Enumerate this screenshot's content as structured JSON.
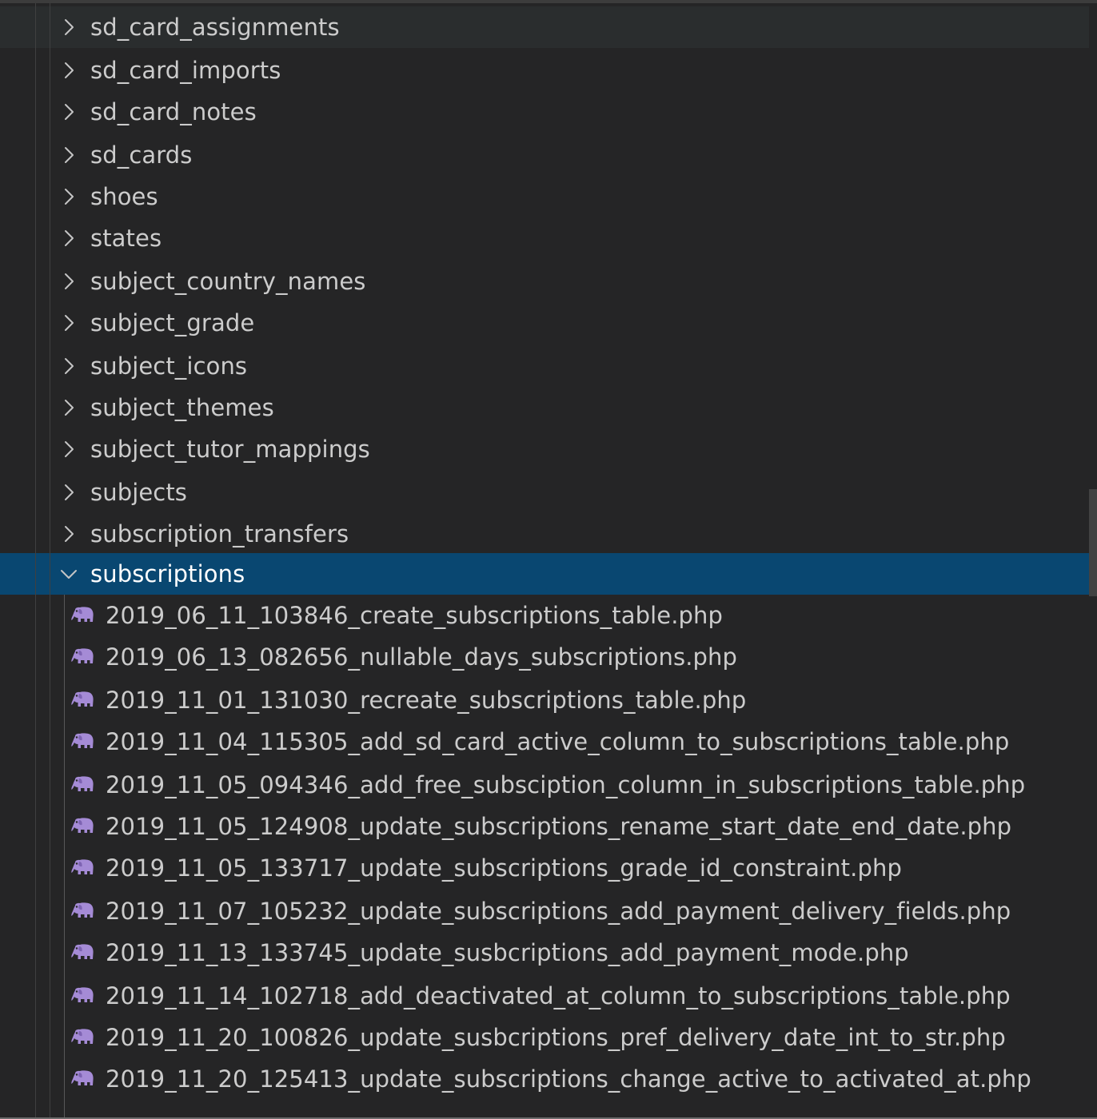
{
  "explorer": {
    "folders": [
      {
        "label": "sd_card_assignments",
        "expanded": false
      },
      {
        "label": "sd_card_imports",
        "expanded": false
      },
      {
        "label": "sd_card_notes",
        "expanded": false
      },
      {
        "label": "sd_cards",
        "expanded": false
      },
      {
        "label": "shoes",
        "expanded": false
      },
      {
        "label": "states",
        "expanded": false
      },
      {
        "label": "subject_country_names",
        "expanded": false
      },
      {
        "label": "subject_grade",
        "expanded": false
      },
      {
        "label": "subject_icons",
        "expanded": false
      },
      {
        "label": "subject_themes",
        "expanded": false
      },
      {
        "label": "subject_tutor_mappings",
        "expanded": false
      },
      {
        "label": "subjects",
        "expanded": false
      },
      {
        "label": "subscription_transfers",
        "expanded": false
      }
    ],
    "open_folder": {
      "label": "subscriptions",
      "expanded": true
    },
    "files": [
      {
        "label": "2019_06_11_103846_create_subscriptions_table.php",
        "icon": "php-elephant-icon"
      },
      {
        "label": "2019_06_13_082656_nullable_days_subscriptions.php",
        "icon": "php-elephant-icon"
      },
      {
        "label": "2019_11_01_131030_recreate_subscriptions_table.php",
        "icon": "php-elephant-icon"
      },
      {
        "label": "2019_11_04_115305_add_sd_card_active_column_to_subscriptions_table.php",
        "icon": "php-elephant-icon"
      },
      {
        "label": "2019_11_05_094346_add_free_subsciption_column_in_subscriptions_table.php",
        "icon": "php-elephant-icon"
      },
      {
        "label": "2019_11_05_124908_update_subscriptions_rename_start_date_end_date.php",
        "icon": "php-elephant-icon"
      },
      {
        "label": "2019_11_05_133717_update_subscriptions_grade_id_constraint.php",
        "icon": "php-elephant-icon"
      },
      {
        "label": "2019_11_07_105232_update_subscriptions_add_payment_delivery_fields.php",
        "icon": "php-elephant-icon"
      },
      {
        "label": "2019_11_13_133745_update_susbcriptions_add_payment_mode.php",
        "icon": "php-elephant-icon"
      },
      {
        "label": "2019_11_14_102718_add_deactivated_at_column_to_subscriptions_table.php",
        "icon": "php-elephant-icon"
      },
      {
        "label": "2019_11_20_100826_update_susbcriptions_pref_delivery_date_int_to_str.php",
        "icon": "php-elephant-icon"
      },
      {
        "label": "2019_11_20_125413_update_subscriptions_change_active_to_activated_at.php",
        "icon": "php-elephant-icon"
      }
    ],
    "colors": {
      "background": "#252526",
      "selection": "#094771",
      "hover_row": "#2a2d2e",
      "text": "#cccccc",
      "php_icon": "#a58bd6"
    }
  }
}
